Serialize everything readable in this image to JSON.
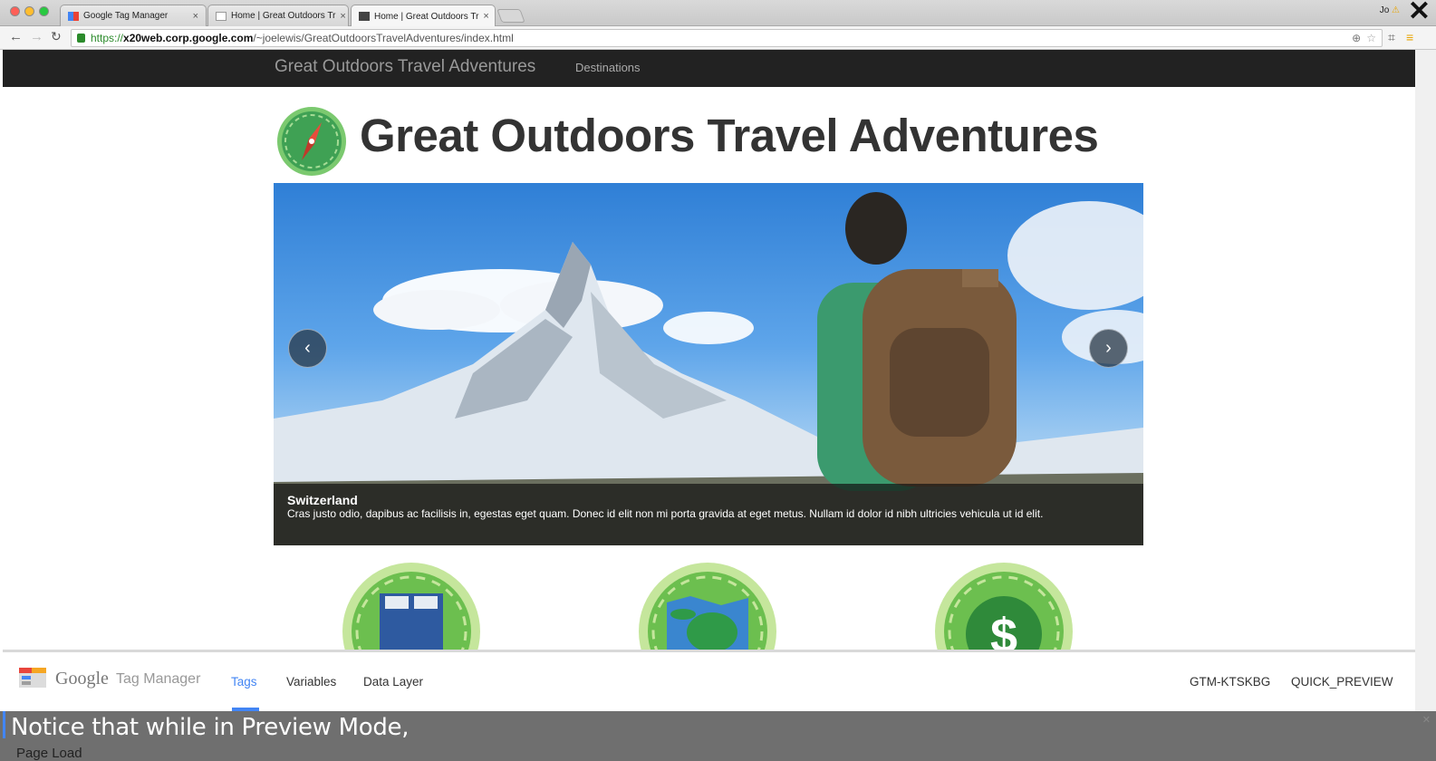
{
  "browser": {
    "tabs": [
      {
        "label": "Google Tag Manager",
        "active": false
      },
      {
        "label": "Home | Great Outdoors Tr",
        "active": false
      },
      {
        "label": "Home | Great Outdoors Tr",
        "active": true
      }
    ],
    "profile_label": "Jo",
    "url_scheme": "https://",
    "url_host": "x20web.corp.google.com",
    "url_path": "/~joelewis/GreatOutdoorsTravelAdventures/index.html"
  },
  "site": {
    "brand": "Great Outdoors Travel Adventures",
    "nav_destinations": "Destinations",
    "hero_title": "Great Outdoors Travel Adventures",
    "carousel": {
      "caption_title": "Switzerland",
      "caption_text": "Cras justo odio, dapibus ac facilisis in, egestas eget quam. Donec id elit non mi porta gravida at eget metus. Nullam id dolor id nibh ultricies vehicula ut id elit.",
      "prev_symbol": "‹",
      "next_symbol": "›"
    }
  },
  "gtm": {
    "brand_google": "Google",
    "brand_product": "Tag Manager",
    "tabs": [
      "Tags",
      "Variables",
      "Data Layer"
    ],
    "container_id": "GTM-KTSKBG",
    "preview_label": "QUICK_PREVIEW"
  },
  "overlay": {
    "subtitle": "Notice that while in Preview Mode,",
    "page_load": "Page Load"
  },
  "colors": {
    "accent_blue": "#4285f4",
    "site_nav_bg": "#222222"
  }
}
